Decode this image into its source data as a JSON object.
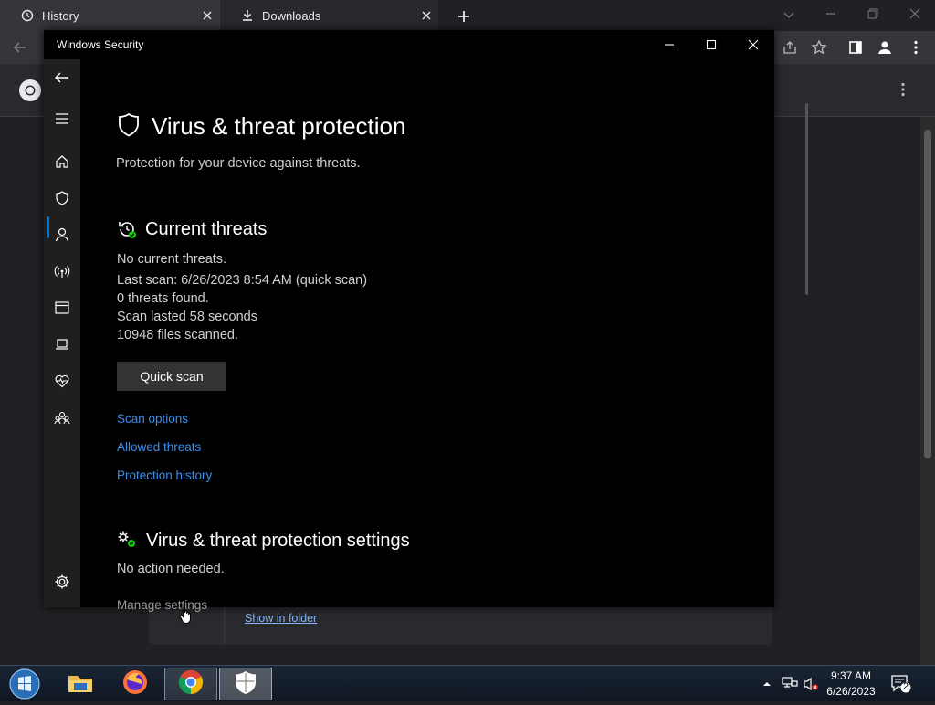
{
  "browser": {
    "tabs": [
      {
        "label": "History",
        "icon": "history-icon"
      },
      {
        "label": "Downloads",
        "icon": "download-icon"
      }
    ],
    "download_item": {
      "show_in_folder": "Show in folder"
    }
  },
  "security": {
    "window_title": "Windows Security",
    "page_title": "Virus & threat protection",
    "page_subtitle": "Protection for your device against threats.",
    "current_threats": {
      "heading": "Current threats",
      "lines": [
        "No current threats.",
        "Last scan: 6/26/2023 8:54 AM (quick scan)",
        "0 threats found.",
        "Scan lasted 58 seconds",
        "10948 files scanned."
      ],
      "quick_scan": "Quick scan",
      "links": [
        "Scan options",
        "Allowed threats",
        "Protection history"
      ]
    },
    "settings": {
      "heading": "Virus & threat protection settings",
      "status": "No action needed.",
      "manage": "Manage settings"
    },
    "accent_color": "#0078d4",
    "link_color": "#3b8eea"
  },
  "taskbar": {
    "time": "9:37 AM",
    "date": "6/26/2023",
    "notification_count": "2"
  }
}
